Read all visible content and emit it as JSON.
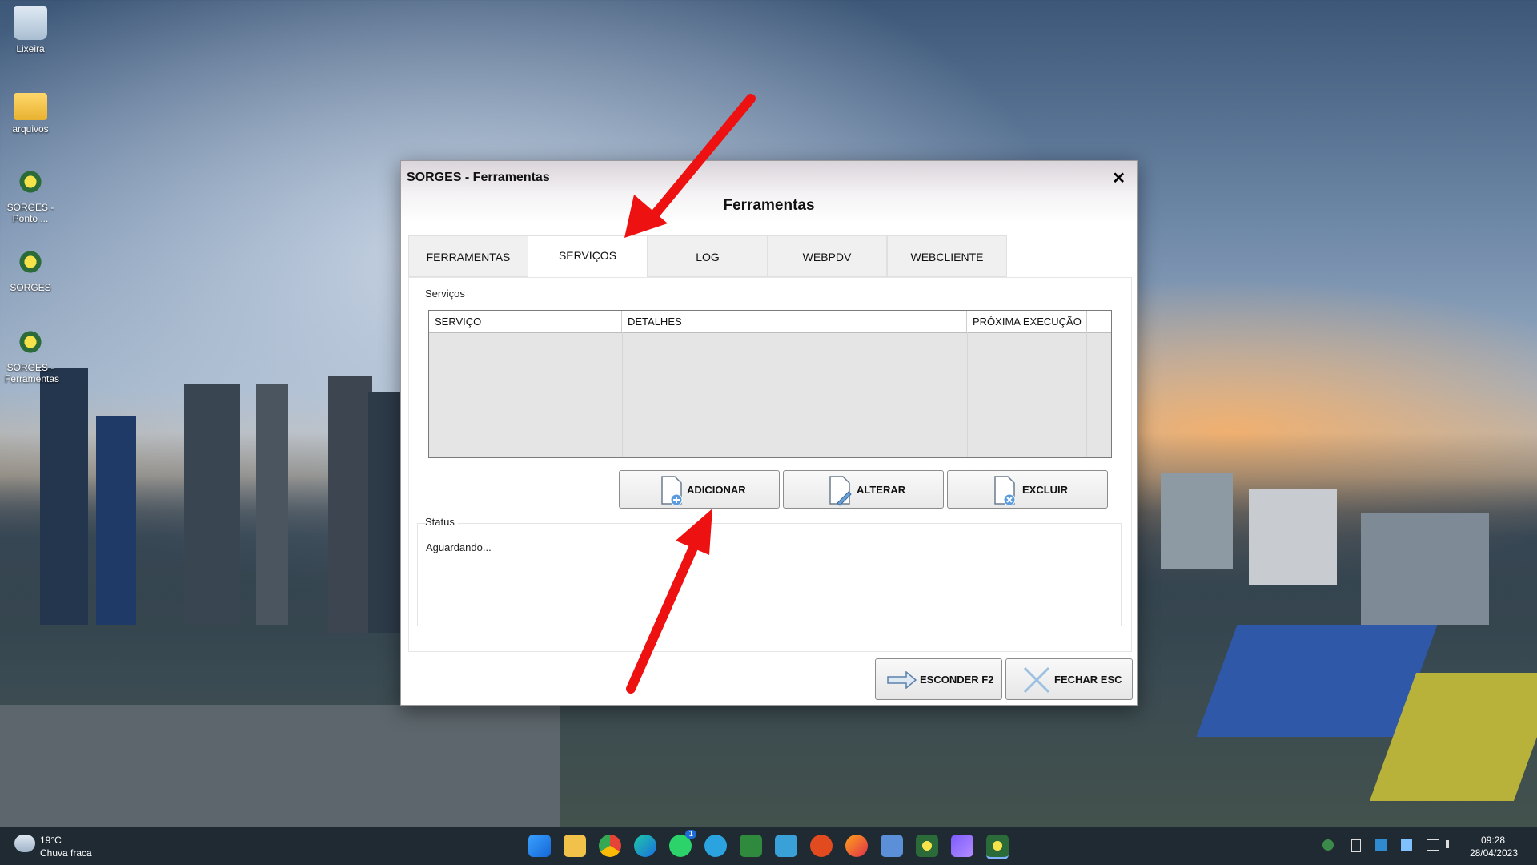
{
  "desktop": {
    "icons": [
      {
        "label": "Lixeira"
      },
      {
        "label": "arquivos"
      },
      {
        "label": "SORGES - Ponto ..."
      },
      {
        "label": "SORGES"
      },
      {
        "label": "SORGES - Ferramentas"
      }
    ]
  },
  "dialog": {
    "title": "SORGES - Ferramentas",
    "close_label": "✕",
    "heading": "Ferramentas",
    "tabs": [
      {
        "label": "FERRAMENTAS"
      },
      {
        "label": "SERVIÇOS"
      },
      {
        "label": "LOG"
      },
      {
        "label": "WEBPDV"
      },
      {
        "label": "WEBCLIENTE"
      }
    ],
    "active_tab": "SERVIÇOS",
    "services_group": {
      "label": "Serviços",
      "columns": [
        "SERVIÇO",
        "DETALHES",
        "PRÓXIMA EXECUÇÃO"
      ],
      "rows": []
    },
    "actions": {
      "add": "ADICIONAR",
      "edit": "ALTERAR",
      "delete": "EXCLUIR"
    },
    "status_group": {
      "label": "Status",
      "text": "Aguardando..."
    },
    "footer": {
      "hide": "ESCONDER F2",
      "close": "FECHAR ESC"
    }
  },
  "taskbar": {
    "weather_temp": "19°C",
    "weather_desc": "Chuva fraca",
    "time": "09:28",
    "date": "28/04/2023",
    "whatsapp_badge": "1"
  },
  "colors": {
    "arrow": "#ee1111",
    "taskbar": "#1f2a33"
  }
}
